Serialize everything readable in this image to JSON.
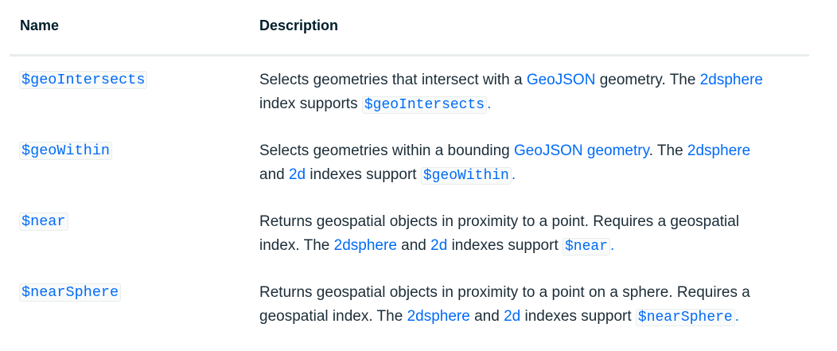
{
  "header": {
    "name": "Name",
    "description": "Description"
  },
  "rows": [
    {
      "name": "$geoIntersects",
      "parts": [
        "Selects geometries that intersect with a ",
        "GeoJSON",
        " geometry. The ",
        "2dsphere",
        "index supports ",
        "$geoIntersects",
        "."
      ]
    },
    {
      "name": "$geoWithin",
      "parts": [
        "Selects geometries within a bounding ",
        "GeoJSON geometry",
        ". The ",
        "2dsphere",
        "and ",
        "2d",
        " indexes support ",
        "$geoWithin",
        "."
      ]
    },
    {
      "name": "$near",
      "parts": [
        "Returns geospatial objects in proximity to a point. Requires a geospatial",
        "index. The ",
        "2dsphere",
        " and ",
        "2d",
        " indexes support ",
        "$near",
        "."
      ]
    },
    {
      "name": "$nearSphere",
      "parts": [
        "Returns geospatial objects in proximity to a point on a sphere. Requires a",
        "geospatial index. The ",
        "2dsphere",
        " and ",
        "2d",
        " indexes support ",
        "$nearSphere",
        "."
      ]
    }
  ],
  "colors": {
    "link": "#016bf8",
    "text": "#1c2d38",
    "divider": "#e8edeb"
  }
}
